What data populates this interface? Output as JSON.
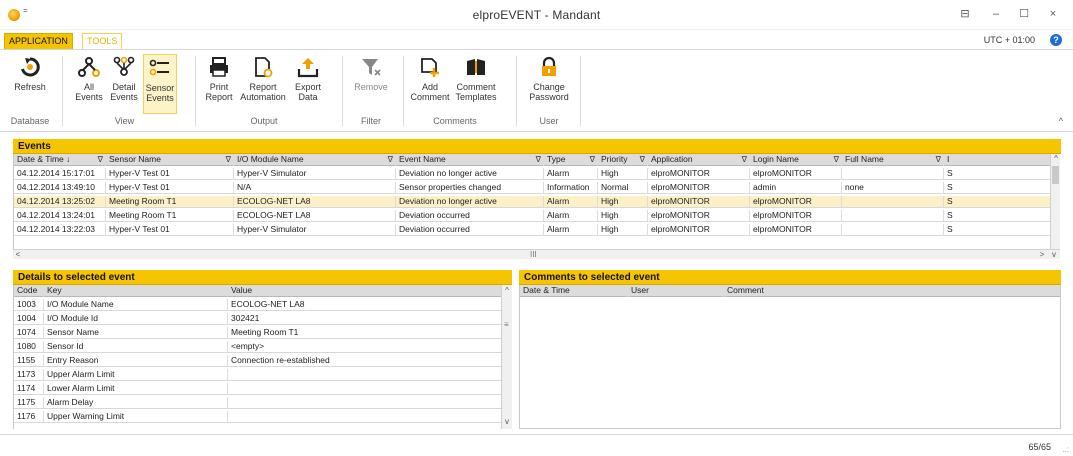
{
  "window": {
    "title": "elproEVENT - Mandant",
    "quick_access_arrow": "=",
    "restore_glyph": "⊟",
    "minimize_glyph": "–",
    "maximize_glyph": "☐",
    "close_glyph": "×"
  },
  "tabs": {
    "application": "APPLICATION",
    "tools": "TOOLS",
    "timezone": "UTC + 01:00",
    "help": "?"
  },
  "ribbon": {
    "buttons": {
      "refresh": "Refresh",
      "all_events_1": "All",
      "all_events_2": "Events",
      "detail_events_1": "Detail",
      "detail_events_2": "Events",
      "sensor_events_1": "Sensor",
      "sensor_events_2": "Events",
      "print_report_1": "Print",
      "print_report_2": "Report",
      "report_automation_1": "Report",
      "report_automation_2": "Automation",
      "export_data_1": "Export",
      "export_data_2": "Data",
      "remove": "Remove",
      "add_comment_1": "Add",
      "add_comment_2": "Comment",
      "comment_templates_1": "Comment",
      "comment_templates_2": "Templates",
      "change_password_1": "Change",
      "change_password_2": "Password"
    },
    "groups": {
      "database": "Database",
      "view": "View",
      "output": "Output",
      "filter": "Filter",
      "comments": "Comments",
      "user": "User"
    },
    "collapse_glyph": "^"
  },
  "events": {
    "title": "Events",
    "filter_glyph": "∇",
    "columns": [
      "Date & Time ↓",
      "Sensor Name",
      "I/O Module Name",
      "Event Name",
      "Type",
      "Priority",
      "Application",
      "Login Name",
      "Full Name",
      "I"
    ],
    "rows": [
      [
        "04.12.2014 15:17:01",
        "Hyper-V Test 01",
        "Hyper-V Simulator",
        "Deviation no longer active",
        "Alarm",
        "High",
        "elproMONITOR",
        "elproMONITOR",
        "",
        "S"
      ],
      [
        "04.12.2014 13:49:10",
        "Hyper-V Test 01",
        "N/A",
        "Sensor properties changed",
        "Information",
        "Normal",
        "elproMONITOR",
        "admin",
        "none",
        "S"
      ],
      [
        "04.12.2014 13:25:02",
        "Meeting Room T1",
        "ECOLOG-NET LA8",
        "Deviation no longer active",
        "Alarm",
        "High",
        "elproMONITOR",
        "elproMONITOR",
        "",
        "S"
      ],
      [
        "04.12.2014 13:24:01",
        "Meeting Room T1",
        "ECOLOG-NET LA8",
        "Deviation occurred",
        "Alarm",
        "High",
        "elproMONITOR",
        "elproMONITOR",
        "",
        "S"
      ],
      [
        "04.12.2014 13:22:03",
        "Hyper-V Test 01",
        "Hyper-V Simulator",
        "Deviation occurred",
        "Alarm",
        "High",
        "elproMONITOR",
        "elproMONITOR",
        "",
        "S"
      ]
    ],
    "selected_row": 2,
    "scroll_left": "<",
    "scroll_right": ">",
    "scroll_up": "^",
    "scroll_down": "v",
    "grip": "III"
  },
  "details": {
    "title": "Details to selected event",
    "columns": [
      "Code",
      "Key",
      "Value"
    ],
    "rows": [
      [
        "1003",
        "I/O Module Name",
        "ECOLOG-NET LA8"
      ],
      [
        "1004",
        "I/O Module Id",
        "302421"
      ],
      [
        "1074",
        "Sensor Name",
        "Meeting Room T1"
      ],
      [
        "1080",
        "Sensor Id",
        "<empty>"
      ],
      [
        "1155",
        "Entry Reason",
        "Connection re-established"
      ],
      [
        "1173",
        "Upper Alarm Limit",
        ""
      ],
      [
        "1174",
        "Lower Alarm Limit",
        ""
      ],
      [
        "1175",
        "Alarm Delay",
        ""
      ],
      [
        "1176",
        "Upper Warning Limit",
        ""
      ]
    ],
    "scroll_up": "^",
    "scroll_down": "v",
    "grip": "≡"
  },
  "comments": {
    "title": "Comments to selected event",
    "columns": [
      "Date & Time",
      "User",
      "Comment"
    ]
  },
  "status": {
    "count": "65/65",
    "grip": "..:"
  },
  "colors": {
    "accent": "#f7c500",
    "selected_row": "#fcf1c6",
    "header_gray": "#dcdcdc",
    "help_blue": "#1e6fd0"
  }
}
